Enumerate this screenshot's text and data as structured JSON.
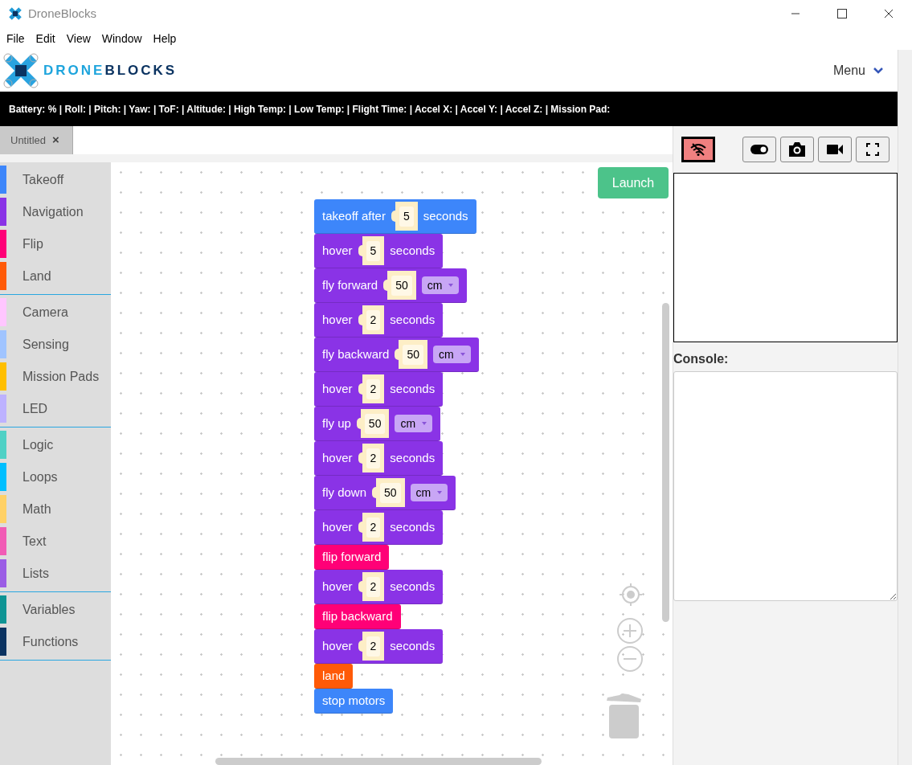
{
  "window": {
    "title": "DroneBlocks"
  },
  "menu": [
    "File",
    "Edit",
    "View",
    "Window",
    "Help"
  ],
  "header": {
    "logo_left": "DRONE",
    "logo_right": "BLOCKS",
    "menu_label": "Menu"
  },
  "status_bar": "Battery: % | Roll: | Pitch: | Yaw: | ToF: | Altitude: | High Temp: | Low Temp: | Flight Time: | Accel X: | Accel Y: | Accel Z: | Mission Pad:",
  "tabs": [
    {
      "label": "Untitled",
      "close": "×",
      "selected": true
    }
  ],
  "categories": [
    [
      {
        "label": "Takeoff",
        "color": "#3d86fa"
      },
      {
        "label": "Navigation",
        "color": "#8a33e6"
      },
      {
        "label": "Flip",
        "color": "#ff0077"
      },
      {
        "label": "Land",
        "color": "#ff5a07"
      }
    ],
    [
      {
        "label": "Camera",
        "color": "#ffc6ff"
      },
      {
        "label": "Sensing",
        "color": "#a0c4ff"
      },
      {
        "label": "Mission Pads",
        "color": "#ffbf00"
      },
      {
        "label": "LED",
        "color": "#bdb2ff"
      }
    ],
    [
      {
        "label": "Logic",
        "color": "#4fd1c5"
      },
      {
        "label": "Loops",
        "color": "#00bfff"
      },
      {
        "label": "Math",
        "color": "#ffd166"
      },
      {
        "label": "Text",
        "color": "#f15bb5"
      },
      {
        "label": "Lists",
        "color": "#9b5de5"
      }
    ],
    [
      {
        "label": "Variables",
        "color": "#0f9494"
      },
      {
        "label": "Functions",
        "color": "#0b3361"
      }
    ]
  ],
  "launch_button": "Launch",
  "blocks": [
    {
      "color": "#3d86fa",
      "parts": [
        {
          "kind": "text",
          "text": "takeoff after"
        },
        {
          "kind": "number",
          "text": "5"
        },
        {
          "kind": "text",
          "text": "seconds"
        }
      ]
    },
    {
      "color": "#8a33e6",
      "parts": [
        {
          "kind": "text",
          "text": "hover"
        },
        {
          "kind": "number",
          "text": "5"
        },
        {
          "kind": "text",
          "text": "seconds"
        }
      ]
    },
    {
      "color": "#8a33e6",
      "parts": [
        {
          "kind": "text",
          "text": "fly forward"
        },
        {
          "kind": "number",
          "text": "50"
        },
        {
          "kind": "dropdown",
          "text": "cm"
        }
      ]
    },
    {
      "color": "#8a33e6",
      "parts": [
        {
          "kind": "text",
          "text": "hover"
        },
        {
          "kind": "number",
          "text": "2"
        },
        {
          "kind": "text",
          "text": "seconds"
        }
      ]
    },
    {
      "color": "#8a33e6",
      "parts": [
        {
          "kind": "text",
          "text": "fly backward"
        },
        {
          "kind": "number",
          "text": "50"
        },
        {
          "kind": "dropdown",
          "text": "cm"
        }
      ]
    },
    {
      "color": "#8a33e6",
      "parts": [
        {
          "kind": "text",
          "text": "hover"
        },
        {
          "kind": "number",
          "text": "2"
        },
        {
          "kind": "text",
          "text": "seconds"
        }
      ]
    },
    {
      "color": "#8a33e6",
      "parts": [
        {
          "kind": "text",
          "text": "fly up"
        },
        {
          "kind": "number",
          "text": "50"
        },
        {
          "kind": "dropdown",
          "text": "cm"
        }
      ]
    },
    {
      "color": "#8a33e6",
      "parts": [
        {
          "kind": "text",
          "text": "hover"
        },
        {
          "kind": "number",
          "text": "2"
        },
        {
          "kind": "text",
          "text": "seconds"
        }
      ]
    },
    {
      "color": "#8a33e6",
      "parts": [
        {
          "kind": "text",
          "text": "fly down"
        },
        {
          "kind": "number",
          "text": "50"
        },
        {
          "kind": "dropdown",
          "text": "cm"
        }
      ]
    },
    {
      "color": "#8a33e6",
      "parts": [
        {
          "kind": "text",
          "text": "hover"
        },
        {
          "kind": "number",
          "text": "2"
        },
        {
          "kind": "text",
          "text": "seconds"
        }
      ]
    },
    {
      "color": "#ff0077",
      "parts": [
        {
          "kind": "text",
          "text": "flip forward"
        }
      ]
    },
    {
      "color": "#8a33e6",
      "parts": [
        {
          "kind": "text",
          "text": "hover"
        },
        {
          "kind": "number",
          "text": "2"
        },
        {
          "kind": "text",
          "text": "seconds"
        }
      ]
    },
    {
      "color": "#ff0077",
      "parts": [
        {
          "kind": "text",
          "text": "flip backward"
        }
      ]
    },
    {
      "color": "#8a33e6",
      "parts": [
        {
          "kind": "text",
          "text": "hover"
        },
        {
          "kind": "number",
          "text": "2"
        },
        {
          "kind": "text",
          "text": "seconds"
        }
      ]
    },
    {
      "color": "#ff5a07",
      "parts": [
        {
          "kind": "text",
          "text": "land"
        }
      ]
    },
    {
      "color": "#3d86fa",
      "parts": [
        {
          "kind": "text",
          "text": "stop motors"
        }
      ]
    }
  ],
  "right_panel": {
    "connected": false,
    "console_label": "Console:"
  }
}
